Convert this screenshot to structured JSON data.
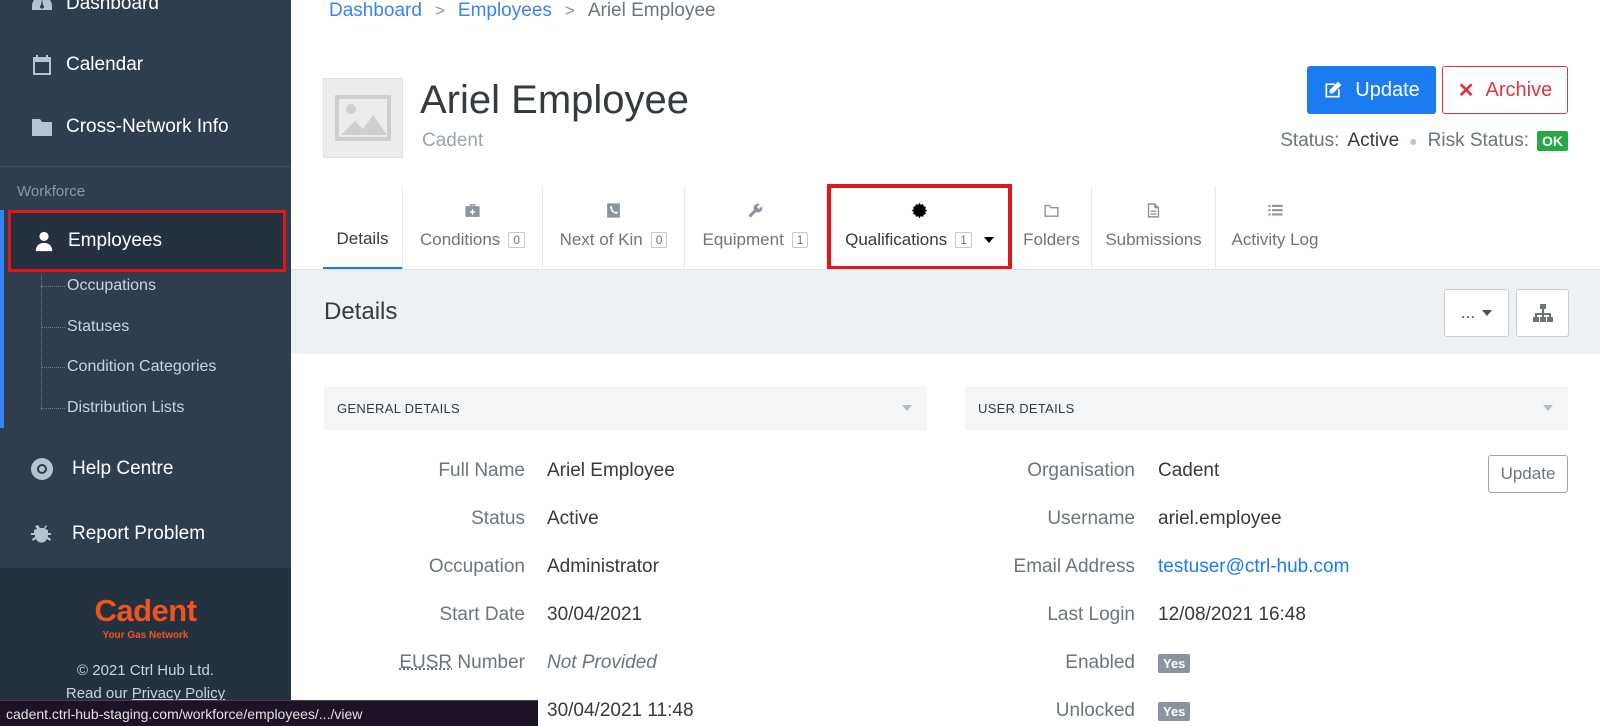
{
  "sidebar": {
    "nav_top": [
      {
        "label": "Dashboard",
        "icon": "dashboard-icon"
      },
      {
        "label": "Calendar",
        "icon": "calendar-icon"
      },
      {
        "label": "Cross-Network Info",
        "icon": "folder-icon"
      }
    ],
    "section_label": "Workforce",
    "active_item": {
      "label": "Employees",
      "icon": "user-icon"
    },
    "sub_items": [
      "Occupations",
      "Statuses",
      "Condition Categories",
      "Distribution Lists"
    ],
    "nav_bottom": [
      {
        "label": "Help Centre",
        "icon": "lifebuoy-icon"
      },
      {
        "label": "Report Problem",
        "icon": "bug-icon"
      }
    ],
    "logo_text": "Cadent",
    "logo_tagline": "Your Gas Network",
    "copyright": "© 2021 Ctrl Hub Ltd.",
    "privacy_prefix": "Read our ",
    "privacy_link": "Privacy Policy"
  },
  "status_bar_url": "cadent.ctrl-hub-staging.com/workforce/employees/.../view",
  "breadcrumb": {
    "items": [
      "Dashboard",
      "Employees"
    ],
    "current": "Ariel Employee",
    "separator": ">"
  },
  "header": {
    "title": "Ariel Employee",
    "organisation": "Cadent",
    "update_label": "Update",
    "archive_label": "Archive",
    "status_label": "Status:",
    "status_value": "Active",
    "risk_label": "Risk Status:",
    "risk_value": "OK"
  },
  "tabs": [
    {
      "label": "Details",
      "count": null,
      "icon": "none"
    },
    {
      "label": "Conditions",
      "count": "0",
      "icon": "medkit-icon"
    },
    {
      "label": "Next of Kin",
      "count": "0",
      "icon": "phone-icon"
    },
    {
      "label": "Equipment",
      "count": "1",
      "icon": "wrench-icon"
    },
    {
      "label": "Qualifications",
      "count": "1",
      "icon": "certificate-icon"
    },
    {
      "label": "Folders",
      "count": null,
      "icon": "folder-outline-icon"
    },
    {
      "label": "Submissions",
      "count": null,
      "icon": "document-icon"
    },
    {
      "label": "Activity Log",
      "count": null,
      "icon": "list-icon"
    }
  ],
  "details": {
    "title": "Details",
    "more_label": "...",
    "general": {
      "header": "GENERAL DETAILS",
      "rows": [
        {
          "label": "Full Name",
          "value": "Ariel Employee"
        },
        {
          "label": "Status",
          "value": "Active"
        },
        {
          "label": "Occupation",
          "value": "Administrator"
        },
        {
          "label": "Start Date",
          "value": "30/04/2021"
        },
        {
          "label_abbr": "EUSR",
          "label": " Number",
          "value": "Not Provided"
        },
        {
          "label": "",
          "value": "30/04/2021 11:48"
        }
      ]
    },
    "user": {
      "header": "USER DETAILS",
      "update_label": "Update",
      "rows": [
        {
          "label": "Organisation",
          "value": "Cadent"
        },
        {
          "label": "Username",
          "value": "ariel.employee"
        },
        {
          "label": "Email Address",
          "value": "testuser@ctrl-hub.com"
        },
        {
          "label": "Last Login",
          "value": "12/08/2021 16:48"
        },
        {
          "label": "Enabled",
          "value": "Yes"
        },
        {
          "label": "Unlocked",
          "value": "Yes"
        }
      ]
    }
  },
  "colors": {
    "primary": "#1a7cf0",
    "danger": "#dc3545",
    "sidebar": "#2f3e4e",
    "highlight": "#e0161d",
    "brand": "#f0531e",
    "ok": "#28a745"
  }
}
